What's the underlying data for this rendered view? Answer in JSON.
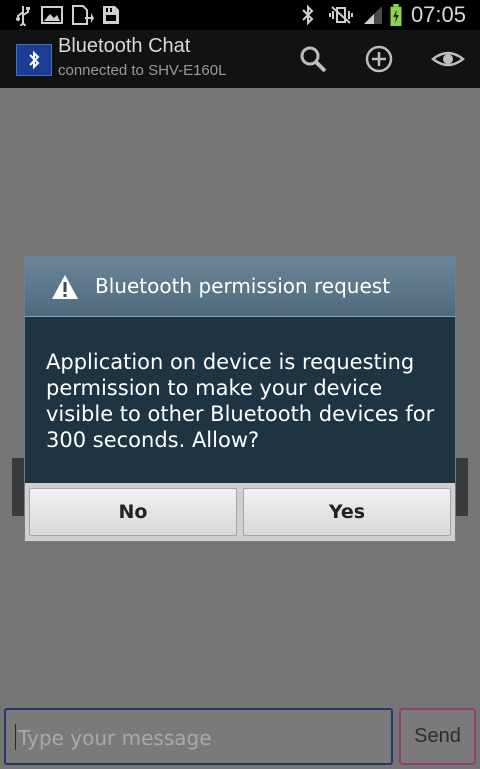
{
  "status_bar": {
    "time": "07:05",
    "icons": [
      "usb-icon",
      "image-icon",
      "file-upload-icon",
      "sd-card-icon",
      "bluetooth-icon",
      "mute-vibrate-icon",
      "signal-icon",
      "battery-charging-icon"
    ]
  },
  "action_bar": {
    "title": "Bluetooth Chat",
    "subtitle": "connected to SHV-E160L",
    "actions": [
      "search-icon",
      "add-icon",
      "visibility-eye-icon"
    ]
  },
  "dialog": {
    "title": "Bluetooth permission request",
    "message": "Application on device is requesting permission to make your device visible to other Bluetooth devices for 300 seconds. Allow?",
    "buttons": {
      "no": "No",
      "yes": "Yes"
    }
  },
  "compose": {
    "placeholder": "Type your message",
    "send_label": "Send"
  },
  "colors": {
    "accent_blue": "#1c3f95",
    "dialog_body": "#1e3442",
    "send_border": "#8f4070"
  }
}
